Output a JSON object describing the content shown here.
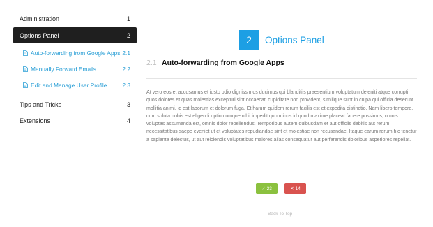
{
  "sidebar": {
    "items": [
      {
        "label": "Administration",
        "num": "1"
      },
      {
        "label": "Options Panel",
        "num": "2"
      },
      {
        "label": "Tips and Tricks",
        "num": "3"
      },
      {
        "label": "Extensions",
        "num": "4"
      }
    ],
    "subitems": [
      {
        "label": "Auto-forwarding from Google Apps",
        "num": "2.1",
        "icon": "document-icon"
      },
      {
        "label": "Manually Forward Emails",
        "num": "2.2",
        "icon": "document-icon"
      },
      {
        "label": "Edit and Manage User Profile",
        "num": "2.3",
        "icon": "document-icon"
      }
    ]
  },
  "main": {
    "chapter_num": "2",
    "chapter_title": "Options Panel",
    "section_num": "2.1",
    "section_title": "Auto-forwarding from Google Apps",
    "body": "At vero eos et accusamus et iusto odio dignissimos ducimus qui blanditiis praesentium voluptatum deleniti atque corrupti quos dolores et quas molestias excepturi sint occaecati cupiditate non provident, similique sunt in culpa qui officia deserunt mollitia animi, id est laborum et dolorum fuga. Et harum quidem rerum facilis est et expedita distinctio. Nam libero tempore, cum soluta nobis est eligendi optio cumque nihil impedit quo minus id quod maxime placeat facere possimus, omnis voluptas assumenda est, omnis dolor repellendus. Temporibus autem quibusdam et aut officiis debitis aut rerum necessitatibus saepe eveniet ut et voluptates repudiandae sint et molestiae non recusandae. Itaque earum rerum hic tenetur a sapiente delectus, ut aut reiciendis voluptatibus maiores alias consequatur aut perferendis doloribus asperiores repellat.",
    "vote_up": "23",
    "vote_down": "14",
    "back_to_top": "Back To Top"
  },
  "colors": {
    "accent": "#1c9fe4",
    "link": "#2a9fd6",
    "active_bg": "#1f1f1f",
    "vote_up": "#8bc13f",
    "vote_down": "#d9534f"
  }
}
